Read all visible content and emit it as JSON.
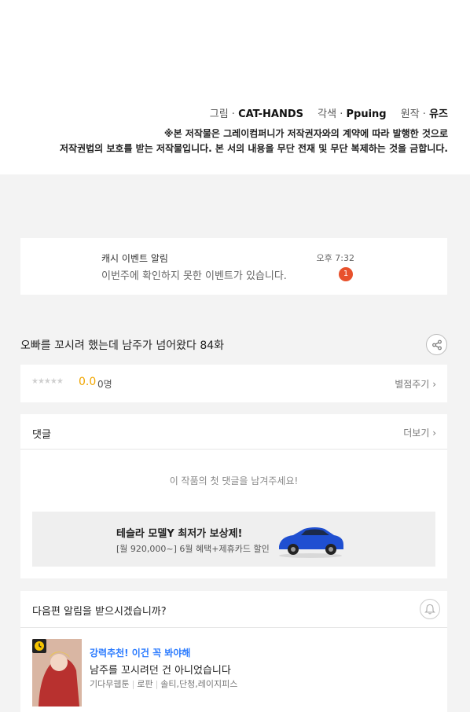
{
  "credits": {
    "art_role": "그림",
    "art_name": "CAT-HANDS",
    "adapt_role": "각색",
    "adapt_name": "Ppuing",
    "orig_role": "원작",
    "orig_name": "유즈",
    "sep": "·"
  },
  "copyright": {
    "line1": "※본 저작물은 그레이컴퍼니가 저작권자와의 계약에 따라 발행한 것으로",
    "line2": "저작권법의 보호를 받는 저작물입니다. 본 서의 내용을 무단 전재 및 무단 복제하는 것을 금합니다."
  },
  "notification": {
    "title": "캐시 이벤트 알림",
    "message": "이번주에 확인하지 못한 이벤트가 있습니다.",
    "time": "오후 7:32",
    "badge": "1"
  },
  "episode": {
    "title": "오빠를 꼬시려 했는데 남주가 넘어왔다 84화"
  },
  "rating": {
    "stars": "★★★★★",
    "score": "0.0",
    "count": "0명",
    "rate_label": "별점주기"
  },
  "comments": {
    "title": "댓글",
    "more_label": "더보기",
    "empty_text": "이 작품의 첫 댓글을 남겨주세요!"
  },
  "ad": {
    "title": "테슬라 모델Y 최저가 보상제!",
    "subtitle": "[월 920,000~] 6월 혜택+제휴카드 할인"
  },
  "next_episode": {
    "question": "다음편 알림을 받으시겠습니까?"
  },
  "recommendation": {
    "tag": "강력추천! 이건 꼭 봐야해",
    "title": "남주를 꼬시려던 건 아니었습니다",
    "meta": [
      "기다무웹툰",
      "로판",
      "솔티,단청,레이지피스"
    ]
  },
  "colors": {
    "accent_blue": "#2b7bff",
    "score_orange": "#f0a500",
    "badge_red": "#e8512c"
  }
}
